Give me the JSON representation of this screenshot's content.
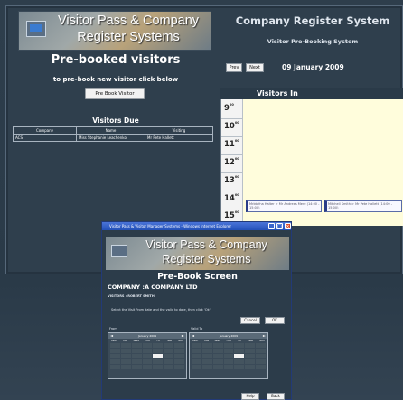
{
  "banner": {
    "line1": "Visitor Pass & Company",
    "line2": "Register Systems"
  },
  "left": {
    "title": "Pre-booked visitors",
    "subtitle": "to pre-book new visitor click below",
    "prebook_button": "Pre Book Visitor",
    "due_title": "Visitors Due",
    "columns": [
      "Company",
      "Name",
      "Visiting"
    ],
    "rows": [
      [
        "ACS",
        "Miss Stephanie Leachenko",
        "Mr Pete Hallett"
      ]
    ]
  },
  "right": {
    "title": "Company Register System",
    "subtitle": "Visitor Pre-Booking System",
    "prev_button": "Prev",
    "next_button": "Next",
    "date": "09 January 2009",
    "visitors_in": "Visitors In",
    "hours": [
      "9",
      "10",
      "11",
      "12",
      "13",
      "14",
      "15"
    ],
    "minutes_suffix": "00",
    "blocks": [
      "Mrbtafna Halter > Mr Andreas Mere (14:00 - 15:00)",
      "Mitchell Smith > Mr Pete Hallett (14:00 - 15:00)"
    ]
  },
  "popup": {
    "window_title": "Visitor Pass & Visitor Manager Systems - Windows Internet Explorer",
    "heading": "Pre-Book Screen",
    "company": "COMPANY :A COMPANY LTD",
    "visitors": "VISITORS : ROBERT SMITH",
    "instruction": "Select the Visit From date and the valid to date, then click 'Ok'",
    "cancel_button": "Cancel",
    "ok_button": "OK",
    "from_label": "From",
    "valid_to_label": "Valid To",
    "from_month": "January 2009",
    "valid_to_month": "January 2009",
    "weekdays": [
      "Mon",
      "Tue",
      "Wed",
      "Thu",
      "Fri",
      "Sat",
      "Sun"
    ],
    "help_button": "Help",
    "back_button": "Back"
  },
  "colors": {
    "page_bg": "#2e3e4c",
    "timeline_bg": "#fffddc",
    "titlebar": "#2350b8"
  }
}
